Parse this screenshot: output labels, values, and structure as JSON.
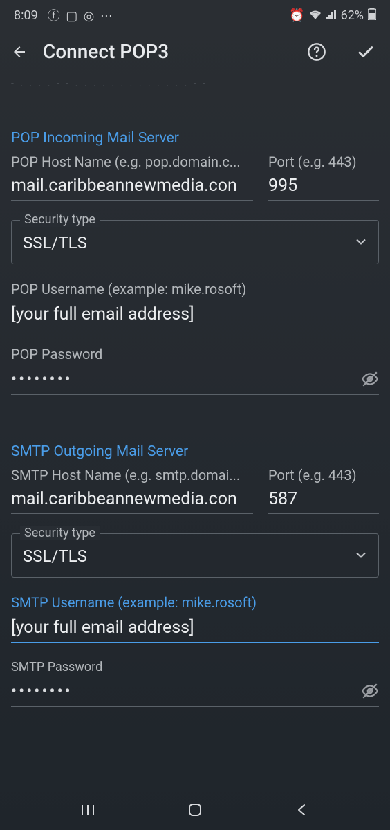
{
  "status": {
    "time": "8:09",
    "battery": "62%"
  },
  "header": {
    "title": "Connect POP3"
  },
  "pop": {
    "section_title": "POP Incoming Mail Server",
    "host_label": "POP Host Name (e.g. pop.domain.c...",
    "host_value": "mail.caribbeannewmedia.con",
    "port_label": "Port (e.g. 443)",
    "port_value": "995",
    "security_label": "Security type",
    "security_value": "SSL/TLS",
    "username_label": "POP Username (example: mike.rosoft)",
    "username_value": "[your full email address]",
    "password_label": "POP Password",
    "password_value": "••••••••"
  },
  "smtp": {
    "section_title": "SMTP Outgoing Mail Server",
    "host_label": "SMTP Host Name (e.g. smtp.domai...",
    "host_value": "mail.caribbeannewmedia.con",
    "port_label": "Port (e.g. 443)",
    "port_value": "587",
    "security_label": "Security type",
    "security_value": "SSL/TLS",
    "username_label": "SMTP Username (example: mike.rosoft)",
    "username_value": "[your full email address]",
    "password_label": "SMTP Password",
    "password_value": "••••••••"
  }
}
